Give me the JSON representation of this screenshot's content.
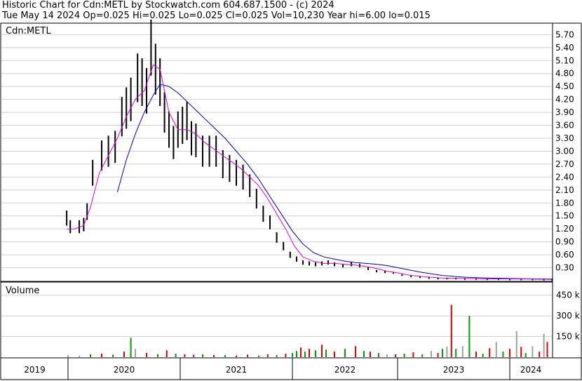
{
  "header": {
    "line1": "Historic Chart for Cdn:METL by Stockwatch.com 604.687.1500 - (c) 2024",
    "line2": "Tue May 14 2024   Op=0.025  Hi=0.025  Lo=0.025  Cl=0.025  Vol=10,230  Year hi=6.00  lo=0.015"
  },
  "colors": {
    "price_bar": "#000000",
    "ma_short": "#e000e0",
    "ma_long": "#0000c0",
    "vol_red": "#e00000",
    "vol_green": "#00a000",
    "vol_gray": "#a0a0a0",
    "grid": "#d0d0d0"
  },
  "chart_data": [
    {
      "type": "line",
      "title": "Cdn:METL",
      "ylim": [
        0,
        5.95
      ],
      "yticks": [
        "5.70",
        "5.40",
        "5.10",
        "4.80",
        "4.50",
        "4.20",
        "3.90",
        "3.60",
        "3.30",
        "3.00",
        "2.70",
        "2.40",
        "2.10",
        "1.80",
        "1.50",
        "1.20",
        "0.90",
        "0.60",
        "0.30"
      ],
      "x_unit": "year",
      "x_years": [
        "2019",
        "2020",
        "2021",
        "2022",
        "2023",
        "2024"
      ],
      "series": [
        {
          "role": "price",
          "x": [
            2019.98,
            2020.02,
            2020.1,
            2020.14,
            2020.17,
            2020.22,
            2020.3,
            2020.36,
            2020.42,
            2020.48,
            2020.52,
            2020.56,
            2020.62,
            2020.66,
            2020.7,
            2020.74,
            2020.78,
            2020.82,
            2020.86,
            2020.9,
            2020.94,
            2020.98,
            2021.02,
            2021.06,
            2021.1,
            2021.14,
            2021.2,
            2021.26,
            2021.32,
            2021.38,
            2021.44,
            2021.5,
            2021.56,
            2021.62,
            2021.68,
            2021.74,
            2021.8,
            2021.86,
            2021.92,
            2021.98,
            2022.04,
            2022.1,
            2022.16,
            2022.22,
            2022.28,
            2022.34,
            2022.4,
            2022.48,
            2022.56,
            2022.64,
            2022.72,
            2022.8,
            2022.88,
            2022.96,
            2023.04,
            2023.12,
            2023.2,
            2023.28,
            2023.36,
            2023.44,
            2023.52,
            2023.6,
            2023.7,
            2023.8,
            2023.9,
            2024.0,
            2024.1,
            2024.2,
            2024.3,
            2024.37
          ],
          "y": [
            1.45,
            1.25,
            1.25,
            1.3,
            1.6,
            2.5,
            2.9,
            3.0,
            3.1,
            3.8,
            4.0,
            4.2,
            4.7,
            4.6,
            4.4,
            5.4,
            4.9,
            4.6,
            3.9,
            3.5,
            3.2,
            3.5,
            3.6,
            3.7,
            3.3,
            3.25,
            3.0,
            3.0,
            3.0,
            2.7,
            2.6,
            2.5,
            2.4,
            2.2,
            1.9,
            1.55,
            1.35,
            1.0,
            0.8,
            0.6,
            0.5,
            0.42,
            0.4,
            0.38,
            0.4,
            0.42,
            0.38,
            0.35,
            0.38,
            0.35,
            0.28,
            0.22,
            0.2,
            0.18,
            0.13,
            0.1,
            0.08,
            0.06,
            0.05,
            0.05,
            0.05,
            0.04,
            0.04,
            0.035,
            0.035,
            0.03,
            0.03,
            0.03,
            0.025,
            0.025
          ]
        },
        {
          "name": "",
          "role": "ma_short",
          "x": [
            2019.98,
            2020.06,
            2020.14,
            2020.2,
            2020.28,
            2020.36,
            2020.44,
            2020.52,
            2020.6,
            2020.68,
            2020.76,
            2020.82,
            2020.9,
            2020.98,
            2021.06,
            2021.14,
            2021.22,
            2021.3,
            2021.38,
            2021.46,
            2021.54,
            2021.62,
            2021.7,
            2021.78,
            2021.86,
            2021.94,
            2022.02,
            2022.1,
            2022.2,
            2022.3,
            2022.4,
            2022.5,
            2022.6,
            2022.7,
            2022.8,
            2022.9,
            2023.0,
            2023.1,
            2023.2,
            2023.3,
            2023.4,
            2023.6,
            2023.8,
            2024.0,
            2024.2,
            2024.37
          ],
          "y": [
            1.2,
            1.2,
            1.28,
            1.7,
            2.5,
            2.9,
            3.3,
            3.8,
            4.2,
            4.4,
            5.0,
            4.9,
            3.9,
            3.5,
            3.5,
            3.4,
            3.2,
            3.05,
            2.9,
            2.75,
            2.6,
            2.4,
            2.2,
            1.9,
            1.55,
            1.2,
            0.8,
            0.55,
            0.45,
            0.4,
            0.4,
            0.38,
            0.36,
            0.33,
            0.28,
            0.22,
            0.18,
            0.13,
            0.1,
            0.08,
            0.06,
            0.05,
            0.04,
            0.04,
            0.035,
            0.03
          ]
        },
        {
          "name": "",
          "role": "ma_long",
          "x": [
            2020.44,
            2020.52,
            2020.6,
            2020.68,
            2020.76,
            2020.82,
            2020.9,
            2020.98,
            2021.06,
            2021.14,
            2021.22,
            2021.3,
            2021.4,
            2021.5,
            2021.6,
            2021.7,
            2021.8,
            2021.9,
            2022.0,
            2022.1,
            2022.2,
            2022.3,
            2022.4,
            2022.5,
            2022.6,
            2022.7,
            2022.8,
            2022.9,
            2023.0,
            2023.1,
            2023.2,
            2023.3,
            2023.4,
            2023.6,
            2023.8,
            2024.0,
            2024.2,
            2024.37
          ],
          "y": [
            2.05,
            2.8,
            3.4,
            3.9,
            4.3,
            4.55,
            4.5,
            4.35,
            4.15,
            3.95,
            3.75,
            3.55,
            3.3,
            3.0,
            2.7,
            2.35,
            1.95,
            1.55,
            1.15,
            0.85,
            0.65,
            0.55,
            0.5,
            0.45,
            0.42,
            0.4,
            0.38,
            0.35,
            0.3,
            0.25,
            0.2,
            0.16,
            0.12,
            0.08,
            0.06,
            0.05,
            0.04,
            0.035
          ]
        }
      ]
    },
    {
      "type": "bar",
      "title": "Volume",
      "ylim": [
        0,
        540
      ],
      "yticks": [
        "450 k",
        "300 k",
        "150 k"
      ],
      "x_unit": "year",
      "series": [
        {
          "role": "volume",
          "x": [
            2020.0,
            2020.1,
            2020.2,
            2020.3,
            2020.4,
            2020.5,
            2020.56,
            2020.6,
            2020.7,
            2020.8,
            2020.88,
            2020.96,
            2021.04,
            2021.12,
            2021.2,
            2021.3,
            2021.4,
            2021.5,
            2021.6,
            2021.7,
            2021.78,
            2021.86,
            2021.94,
            2022.0,
            2022.04,
            2022.08,
            2022.12,
            2022.16,
            2022.22,
            2022.28,
            2022.32,
            2022.4,
            2022.5,
            2022.6,
            2022.68,
            2022.74,
            2022.82,
            2022.9,
            2022.98,
            2023.06,
            2023.14,
            2023.22,
            2023.3,
            2023.36,
            2023.4,
            2023.44,
            2023.48,
            2023.52,
            2023.58,
            2023.64,
            2023.7,
            2023.76,
            2023.82,
            2023.88,
            2023.94,
            2024.0,
            2024.06,
            2024.1,
            2024.14,
            2024.2,
            2024.26,
            2024.3,
            2024.33
          ],
          "y": [
            15,
            10,
            20,
            25,
            18,
            40,
            140,
            60,
            30,
            22,
            50,
            25,
            20,
            18,
            20,
            15,
            15,
            12,
            18,
            12,
            20,
            15,
            25,
            30,
            45,
            70,
            40,
            60,
            50,
            90,
            55,
            40,
            60,
            80,
            45,
            40,
            30,
            20,
            20,
            25,
            35,
            20,
            45,
            30,
            60,
            75,
            380,
            60,
            80,
            300,
            40,
            25,
            65,
            110,
            40,
            60,
            190,
            75,
            30,
            80,
            40,
            170,
            110
          ],
          "colors": [
            "gray",
            "gray",
            "green",
            "red",
            "green",
            "red",
            "green",
            "gray",
            "red",
            "green",
            "red",
            "green",
            "red",
            "red",
            "green",
            "red",
            "green",
            "red",
            "red",
            "green",
            "red",
            "green",
            "red",
            "green",
            "green",
            "red",
            "green",
            "red",
            "green",
            "red",
            "green",
            "red",
            "green",
            "red",
            "green",
            "red",
            "green",
            "gray",
            "red",
            "green",
            "red",
            "green",
            "gray",
            "red",
            "green",
            "gray",
            "red",
            "green",
            "gray",
            "green",
            "red",
            "green",
            "red",
            "gray",
            "green",
            "red",
            "gray",
            "red",
            "green",
            "gray",
            "red",
            "gray",
            "red"
          ]
        }
      ]
    }
  ]
}
